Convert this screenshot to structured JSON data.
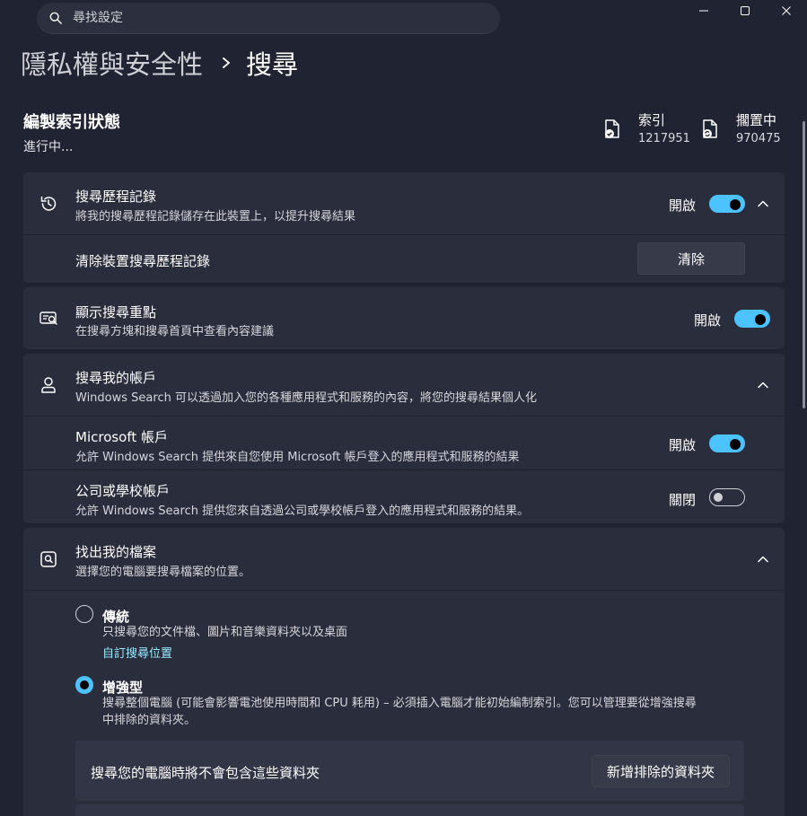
{
  "search": {
    "placeholder": "尋找設定"
  },
  "breadcrumb": {
    "parent": "隱私權與安全性",
    "current": "搜尋"
  },
  "indexing": {
    "title": "編製索引狀態",
    "status": "進行中...",
    "indexed": {
      "label": "索引",
      "value": "1217951"
    },
    "pending": {
      "label": "擱置中",
      "value": "970475"
    }
  },
  "history": {
    "title": "搜尋歷程記錄",
    "desc": "將我的搜尋歷程記錄儲存在此裝置上，以提升搜尋結果",
    "toggle_label": "開啟",
    "toggle_on": true,
    "clear_row_label": "清除裝置搜尋歷程記錄",
    "clear_button": "清除"
  },
  "highlights": {
    "title": "顯示搜尋重點",
    "desc": "在搜尋方塊和搜尋首頁中查看內容建議",
    "toggle_label": "開啟",
    "toggle_on": true
  },
  "accounts": {
    "title": "搜尋我的帳戶",
    "desc": "Windows Search 可以透過加入您的各種應用程式和服務的內容，將您的搜尋結果個人化",
    "microsoft": {
      "title": "Microsoft 帳戶",
      "desc": "允許 Windows Search 提供來自您使用 Microsoft 帳戶登入的應用程式和服務的結果",
      "toggle_label": "開啟",
      "toggle_on": true
    },
    "work": {
      "title": "公司或學校帳戶",
      "desc": "允許 Windows Search 提供您來自透過公司或學校帳戶登入的應用程式和服務的結果。",
      "toggle_label": "關閉",
      "toggle_on": false
    }
  },
  "files": {
    "title": "找出我的檔案",
    "desc": "選擇您的電腦要搜尋檔案的位置。",
    "classic": {
      "title": "傳統",
      "desc": "只搜尋您的文件檔、圖片和音樂資料夾以及桌面",
      "link": "自訂搜尋位置",
      "selected": false
    },
    "enhanced": {
      "title": "增強型",
      "desc_line1": "搜尋整個電腦 (可能會影響電池使用時間和 CPU 耗用) – 必須插入電腦才能初始編制索引。您可以管理要從增強搜尋",
      "desc_line2": "中排除的資料夾。",
      "selected": true
    },
    "excluded": {
      "label": "搜尋您的電腦時將不會包含這些資料夾",
      "button": "新增排除的資料夾"
    }
  },
  "colors": {
    "accent": "#4cc2ff",
    "link": "#99ebff",
    "background": "#202331",
    "card": "#2a2d3c"
  }
}
